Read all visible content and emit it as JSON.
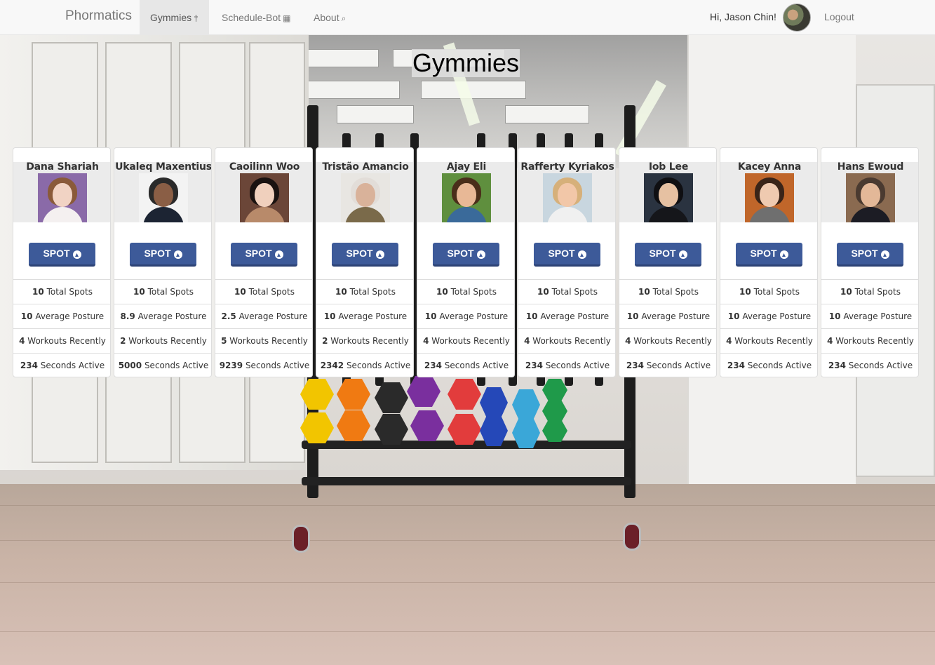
{
  "navbar": {
    "brand": "Phormatics",
    "items": [
      {
        "label": "Gymmies",
        "icon": "†"
      },
      {
        "label": "Schedule-Bot",
        "icon": "▦"
      },
      {
        "label": "About",
        "icon": "⌕"
      }
    ],
    "greeting": "Hi, Jason Chin!",
    "logout": "Logout"
  },
  "page_title": "Gymmies",
  "spot_label": "SPOT",
  "spot_icon": "▴",
  "stat_labels": {
    "spots": "Total Spots",
    "posture": "Average Posture",
    "workouts": "Workouts Recently",
    "seconds": "Seconds Active"
  },
  "gymmies": [
    {
      "name": "Dana Shariah",
      "spots": "10",
      "posture": "10",
      "workouts": "4",
      "seconds": "234"
    },
    {
      "name": "Ukaleq Maxentius",
      "spots": "10",
      "posture": "8.9",
      "workouts": "2",
      "seconds": "5000"
    },
    {
      "name": "Caoilinn Woo",
      "spots": "10",
      "posture": "2.5",
      "workouts": "5",
      "seconds": "9239"
    },
    {
      "name": "Tristão Amancio",
      "spots": "10",
      "posture": "10",
      "workouts": "2",
      "seconds": "2342"
    },
    {
      "name": "Ajay Eli",
      "spots": "10",
      "posture": "10",
      "workouts": "4",
      "seconds": "234"
    },
    {
      "name": "Rafferty Kyriakos",
      "spots": "10",
      "posture": "10",
      "workouts": "4",
      "seconds": "234"
    },
    {
      "name": "Iob Lee",
      "spots": "10",
      "posture": "10",
      "workouts": "4",
      "seconds": "234"
    },
    {
      "name": "Kacey Anna",
      "spots": "10",
      "posture": "10",
      "workouts": "4",
      "seconds": "234"
    },
    {
      "name": "Hans Ewoud",
      "spots": "10",
      "posture": "10",
      "workouts": "4",
      "seconds": "234"
    }
  ],
  "colors": {
    "spot_button": "#3d5a99",
    "navbar_bg": "#f8f8f8"
  }
}
